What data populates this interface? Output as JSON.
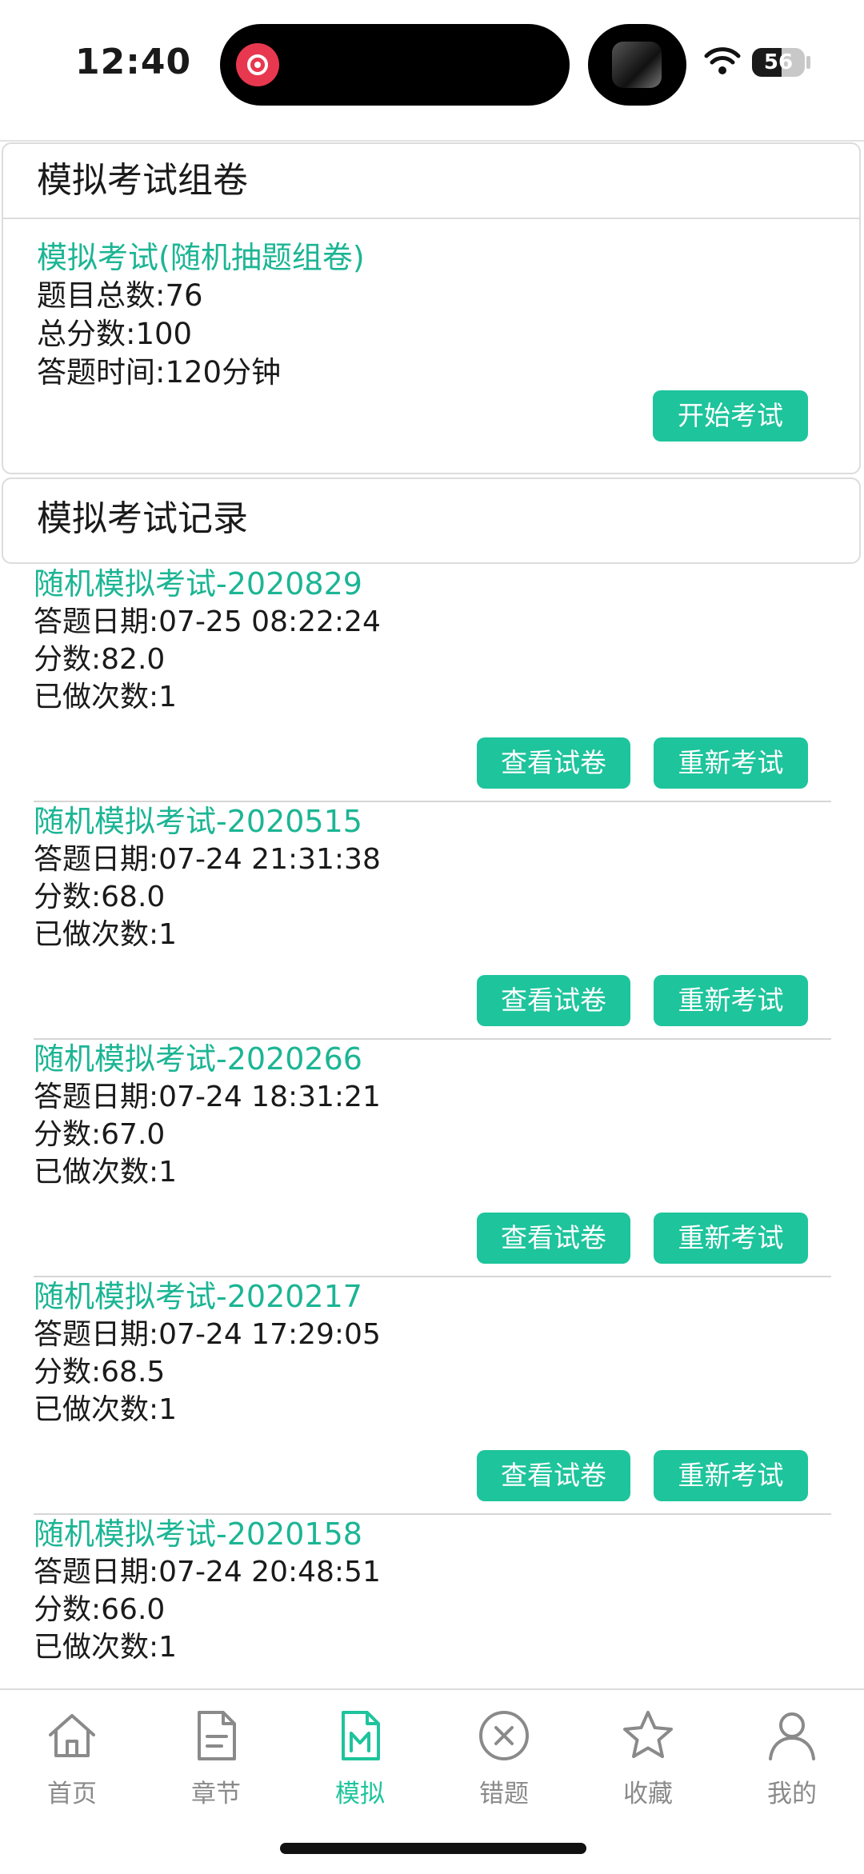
{
  "status_bar": {
    "time": "12:40",
    "battery": "56",
    "battery_level": 0.56
  },
  "compose": {
    "header": "模拟考试组卷",
    "exam_name": "模拟考试(随机抽题组卷)",
    "total_questions": "题目总数:76",
    "total_score": "总分数:100",
    "duration": "答题时间:120分钟",
    "start_button": "开始考试"
  },
  "records": {
    "header": "模拟考试记录",
    "view_button": "查看试卷",
    "retake_button": "重新考试",
    "items": [
      {
        "title": "随机模拟考试-2020829",
        "date": "答题日期:07-25 08:22:24",
        "score": "分数:82.0",
        "attempts": "已做次数:1"
      },
      {
        "title": "随机模拟考试-2020515",
        "date": "答题日期:07-24 21:31:38",
        "score": "分数:68.0",
        "attempts": "已做次数:1"
      },
      {
        "title": "随机模拟考试-2020266",
        "date": "答题日期:07-24 18:31:21",
        "score": "分数:67.0",
        "attempts": "已做次数:1"
      },
      {
        "title": "随机模拟考试-2020217",
        "date": "答题日期:07-24 17:29:05",
        "score": "分数:68.5",
        "attempts": "已做次数:1"
      },
      {
        "title": "随机模拟考试-2020158",
        "date": "答题日期:07-24 20:48:51",
        "score": "分数:66.0",
        "attempts": "已做次数:1"
      }
    ]
  },
  "tabs": [
    {
      "label": "首页",
      "icon": "home-icon"
    },
    {
      "label": "章节",
      "icon": "document-icon"
    },
    {
      "label": "模拟",
      "icon": "mock-exam-icon",
      "active": true
    },
    {
      "label": "错题",
      "icon": "wrong-answer-icon"
    },
    {
      "label": "收藏",
      "icon": "star-icon"
    },
    {
      "label": "我的",
      "icon": "user-icon"
    }
  ],
  "colors": {
    "accent": "#1ec49c",
    "accent_text": "#1cb594",
    "tab_inactive": "#8a8a8a"
  }
}
